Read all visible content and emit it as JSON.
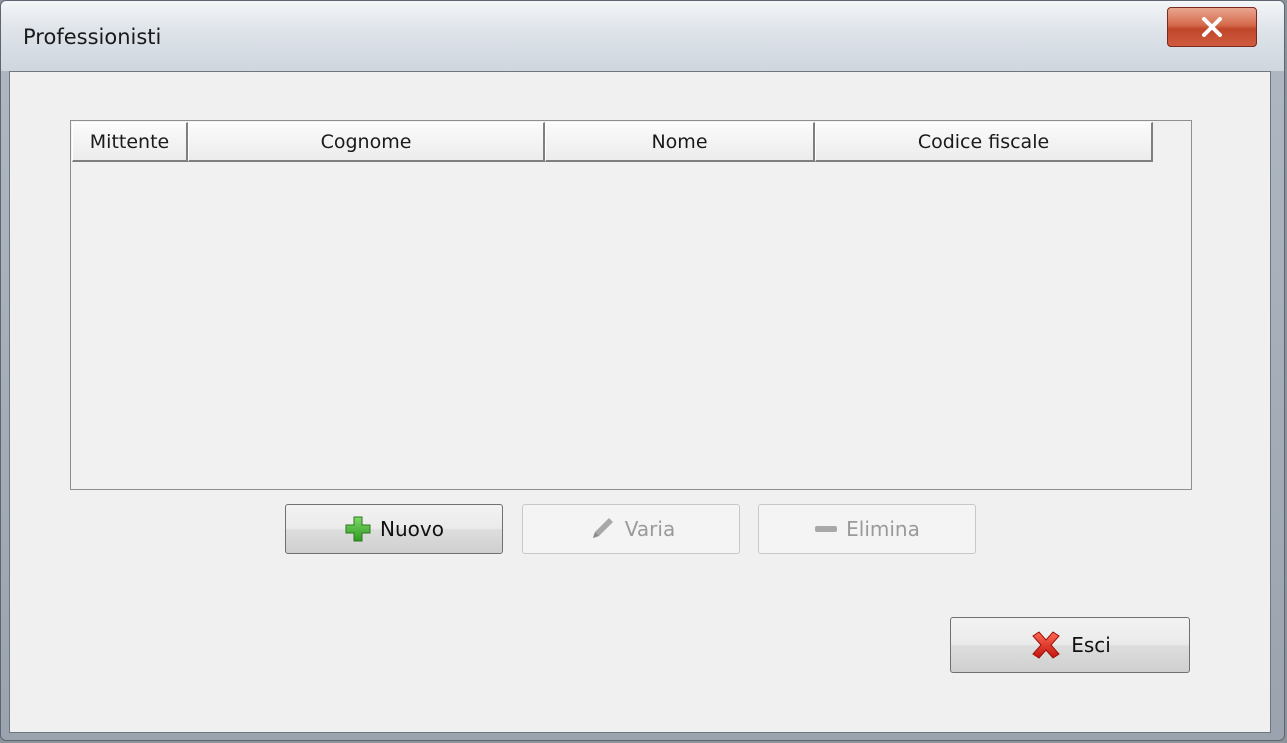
{
  "window": {
    "title": "Professionisti"
  },
  "grid": {
    "columns": [
      {
        "key": "mittente",
        "label": "Mittente"
      },
      {
        "key": "cognome",
        "label": "Cognome"
      },
      {
        "key": "nome",
        "label": "Nome"
      },
      {
        "key": "codice_fiscale",
        "label": "Codice fiscale"
      }
    ],
    "rows": []
  },
  "buttons": {
    "nuovo": {
      "label": "Nuovo",
      "enabled": true,
      "icon": "plus-icon",
      "icon_color": "#3aa626"
    },
    "varia": {
      "label": "Varia",
      "enabled": false,
      "icon": "pencil-icon"
    },
    "elimina": {
      "label": "Elimina",
      "enabled": false,
      "icon": "minus-icon"
    },
    "esci": {
      "label": "Esci",
      "enabled": true,
      "icon": "red-x-icon",
      "icon_color": "#d8261c"
    }
  },
  "colors": {
    "close_button": "#c9502f",
    "dialog_background": "#f0f0f0"
  }
}
